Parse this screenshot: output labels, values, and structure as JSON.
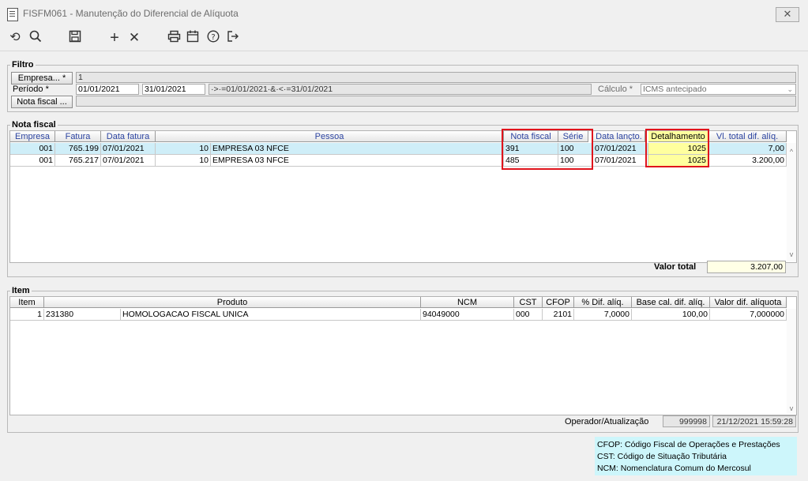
{
  "window": {
    "title": "FISFM061 - Manutenção do Diferencial de Alíquota",
    "close_label": "✕"
  },
  "toolbar": {
    "icons": [
      "refresh-icon",
      "search-icon",
      "save-icon",
      "add-icon",
      "delete-icon",
      "print-icon",
      "calendar-icon",
      "help-icon",
      "exit-icon"
    ]
  },
  "filtro": {
    "legend": "Filtro",
    "empresa_btn": "Empresa... *",
    "empresa_value": "1",
    "periodo_label": "Período *",
    "periodo_start": "01/01/2021",
    "periodo_end": "31/01/2021",
    "periodo_expr": "·>·=01/01/2021·&·<·=31/01/2021",
    "calculo_label": "Cálculo *",
    "calculo_value": "ICMS antecipado",
    "nota_btn": "Nota fiscal ...",
    "nota_value": ""
  },
  "nota_fiscal": {
    "legend": "Nota fiscal",
    "columns": [
      "Empresa",
      "Fatura",
      "Data fatura",
      "Pessoa",
      "Nota fiscal",
      "Série",
      "Data lançto.",
      "Detalhamento",
      "Vl. total dif. alíq."
    ],
    "rows": [
      {
        "empresa": "001",
        "fatura": "765.199",
        "data_fatura": "07/01/2021",
        "pessoa_cod": "10",
        "pessoa_nome": "EMPRESA 03 NFCE",
        "nota": "391",
        "serie": "100",
        "data_lanc": "07/01/2021",
        "detalhamento": "1025",
        "vl_total": "7,00"
      },
      {
        "empresa": "001",
        "fatura": "765.217",
        "data_fatura": "07/01/2021",
        "pessoa_cod": "10",
        "pessoa_nome": "EMPRESA 03 NFCE",
        "nota": "485",
        "serie": "100",
        "data_lanc": "07/01/2021",
        "detalhamento": "1025",
        "vl_total": "3.200,00"
      }
    ],
    "total_label": "Valor total",
    "total_value": "3.207,00"
  },
  "item": {
    "legend": "Item",
    "columns": [
      "Item",
      "Produto",
      "NCM",
      "CST",
      "CFOP",
      "% Dif. alíq.",
      "Base cal. dif. alíq.",
      "Valor dif. alíquota"
    ],
    "rows": [
      {
        "item": "1",
        "cod": "231380",
        "produto": "HOMOLOGACAO FISCAL UNICA",
        "ncm": "94049000",
        "cst": "000",
        "cfop": "2101",
        "pct": "7,0000",
        "base": "100,00",
        "valor": "7,000000"
      }
    ],
    "operador_label": "Operador/Atualização",
    "operador_value": "999998",
    "atualizacao_value": "21/12/2021 15:59:28"
  },
  "legend_notes": [
    "CFOP: Código Fiscal de Operações e Prestações",
    "CST: Código de Situação Tributária",
    "NCM: Nomenclatura Comum do Mercosul"
  ],
  "colors": {
    "highlight_red": "#e0141c",
    "selected_row": "#cfeef8",
    "yellow": "#ffff9e",
    "legend_bg": "#cdf6fb"
  }
}
